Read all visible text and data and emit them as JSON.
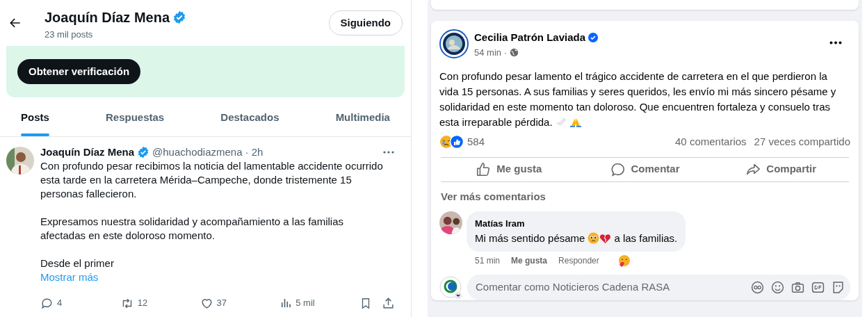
{
  "x_profile": {
    "header": {
      "name": "Joaquín Díaz Mena",
      "posts_count": "23 mil posts",
      "follow_button": "Siguiendo"
    },
    "promo": {
      "button": "Obtener verificación"
    },
    "tabs": [
      {
        "label": "Posts",
        "selected": true
      },
      {
        "label": "Respuestas",
        "selected": false
      },
      {
        "label": "Destacados",
        "selected": false
      },
      {
        "label": "Multimedia",
        "selected": false
      }
    ],
    "post": {
      "author": "Joaquín Díaz Mena",
      "handle": "@huachodiazmena",
      "time": "· 2h",
      "paragraphs": [
        "Con profundo pesar recibimos la noticia del lamentable accidente ocurrido esta tarde en la carretera Mérida–Campeche, donde tristemente 15 personas fallecieron.",
        "Expresamos nuestra solidaridad y acompañamiento a las familias afectadas en este doloroso momento.",
        "Desde el primer"
      ],
      "show_more": "Mostrar más",
      "actions": [
        {
          "kind": "reply",
          "count": "4"
        },
        {
          "kind": "repost",
          "count": "12"
        },
        {
          "kind": "like",
          "count": "37"
        },
        {
          "kind": "views",
          "count": "5 mil"
        },
        {
          "kind": "bookmark"
        },
        {
          "kind": "share"
        }
      ]
    }
  },
  "facebook_post": {
    "author": "Cecilia Patrón Laviada",
    "time": "54 min ·",
    "text": "Con profundo pesar lamento el trágico accidente de carretera en el que perdieron la vida 15 personas. A sus familias y seres queridos, les envío mi más sincero pésame y solidaridad en este momento tan doloroso. Que encuentren fortaleza y consuelo tras",
    "text_end": "esta irreparable pérdida.",
    "reactions_count": "584",
    "comments_count": "40 comentarios",
    "shares_count": "27 veces compartido",
    "actions": [
      {
        "kind": "like",
        "label": "Me gusta"
      },
      {
        "kind": "comment",
        "label": "Comentar"
      },
      {
        "kind": "share",
        "label": "Compartir"
      }
    ],
    "see_more": "Ver más comentarios",
    "comment": {
      "author": "Matías Iram",
      "text_before": "Mi más sentido pésame",
      "text_after": "a las familias.",
      "time": "51 min",
      "like": "Me gusta",
      "reply": "Responder"
    },
    "composer": {
      "placeholder": "Comentar como Noticieros Cadena RASA"
    }
  }
}
